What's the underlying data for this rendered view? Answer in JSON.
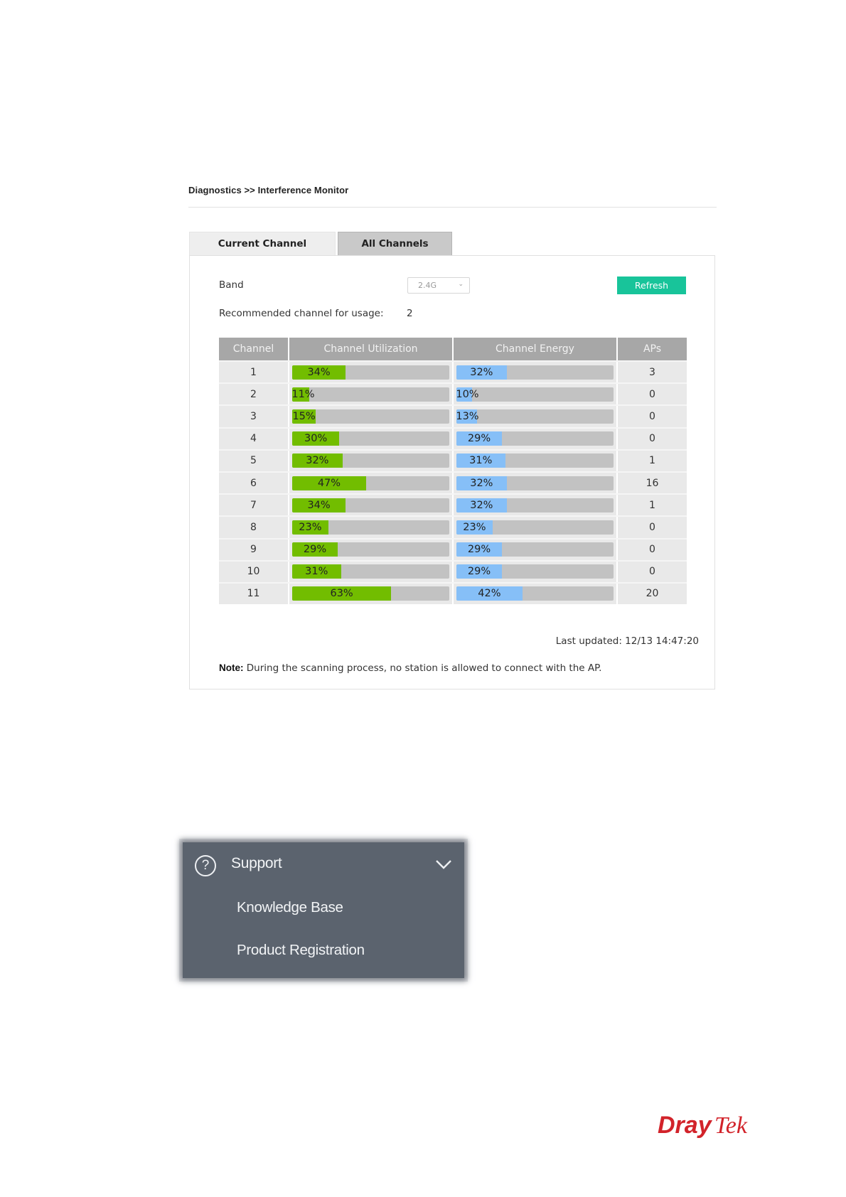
{
  "breadcrumb": "Diagnostics >> Interference Monitor",
  "tabs": [
    {
      "label": "Current Channel",
      "active": false
    },
    {
      "label": "All Channels",
      "active": true
    }
  ],
  "band": {
    "label": "Band",
    "value": "2.4G"
  },
  "refresh_label": "Refresh",
  "recommended": {
    "label": "Recommended channel for usage:",
    "value": "2"
  },
  "table": {
    "headers": [
      "Channel",
      "Channel Utilization",
      "Channel Energy",
      "APs"
    ],
    "rows": [
      {
        "channel": "1",
        "utilization": 34,
        "energy": 32,
        "aps": "3"
      },
      {
        "channel": "2",
        "utilization": 11,
        "energy": 10,
        "aps": "0"
      },
      {
        "channel": "3",
        "utilization": 15,
        "energy": 13,
        "aps": "0"
      },
      {
        "channel": "4",
        "utilization": 30,
        "energy": 29,
        "aps": "0"
      },
      {
        "channel": "5",
        "utilization": 32,
        "energy": 31,
        "aps": "1"
      },
      {
        "channel": "6",
        "utilization": 47,
        "energy": 32,
        "aps": "16"
      },
      {
        "channel": "7",
        "utilization": 34,
        "energy": 32,
        "aps": "1"
      },
      {
        "channel": "8",
        "utilization": 23,
        "energy": 23,
        "aps": "0"
      },
      {
        "channel": "9",
        "utilization": 29,
        "energy": 29,
        "aps": "0"
      },
      {
        "channel": "10",
        "utilization": 31,
        "energy": 29,
        "aps": "0"
      },
      {
        "channel": "11",
        "utilization": 63,
        "energy": 42,
        "aps": "20"
      }
    ]
  },
  "last_updated": "Last updated: 12/13 14:47:20",
  "note": {
    "label": "Note:",
    "text": " During the scanning process, no station is allowed to connect with the AP."
  },
  "support_menu": {
    "title": "Support",
    "items": [
      "Knowledge Base",
      "Product Registration"
    ]
  },
  "logo_text": "DrayTek",
  "colors": {
    "refresh": "#18c49a",
    "utilization_bar": "#72bd00",
    "energy_bar": "#86bff7",
    "menu_bg": "#5b636e",
    "logo": "#d2232a"
  },
  "icons": {
    "support": "question-circle-icon",
    "chevron": "chevron-down-icon",
    "band_select": "chevron-down-icon"
  }
}
